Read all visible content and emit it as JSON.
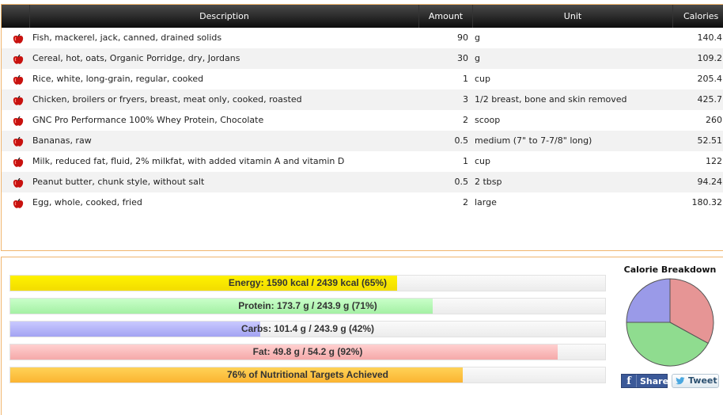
{
  "table": {
    "headers": {
      "description": "Description",
      "amount": "Amount",
      "unit": "Unit",
      "calories": "Calories"
    },
    "rows": [
      {
        "description": "Fish, mackerel, jack, canned, drained solids",
        "amount": "90",
        "unit": "g",
        "calories": "140.4"
      },
      {
        "description": "Cereal, hot, oats, Organic Porridge, dry, Jordans",
        "amount": "30",
        "unit": "g",
        "calories": "109.2"
      },
      {
        "description": "Rice, white, long-grain, regular, cooked",
        "amount": "1",
        "unit": "cup",
        "calories": "205.4"
      },
      {
        "description": "Chicken, broilers or fryers, breast, meat only, cooked, roasted",
        "amount": "3",
        "unit": "1/2 breast, bone and skin removed",
        "calories": "425.7"
      },
      {
        "description": "GNC Pro Performance 100% Whey Protein, Chocolate",
        "amount": "2",
        "unit": "scoop",
        "calories": "260"
      },
      {
        "description": "Bananas, raw",
        "amount": "0.5",
        "unit": "medium (7\" to 7-7/8\" long)",
        "calories": "52.51"
      },
      {
        "description": "Milk, reduced fat, fluid, 2% milkfat, with added vitamin A and vitamin D",
        "amount": "1",
        "unit": "cup",
        "calories": "122"
      },
      {
        "description": "Peanut butter, chunk style, without salt",
        "amount": "0.5",
        "unit": "2 tbsp",
        "calories": "94.24"
      },
      {
        "description": "Egg, whole, cooked, fried",
        "amount": "2",
        "unit": "large",
        "calories": "180.32"
      }
    ]
  },
  "nutrition": {
    "energy": {
      "label": "Energy: 1590 kcal / 2439 kcal (65%)",
      "percent": 65,
      "color": "#f7e600"
    },
    "protein": {
      "label": "Protein: 173.7 g / 243.9 g (71%)",
      "percent": 71,
      "color": "#b5f7b5"
    },
    "carbs": {
      "label": "Carbs: 101.4 g / 243.9 g (42%)",
      "percent": 42,
      "color": "#b5b5f7"
    },
    "fat": {
      "label": "Fat: 49.8 g / 54.2 g (92%)",
      "percent": 92,
      "color": "#f7bcbc"
    },
    "overall": {
      "label": "76% of Nutritional Targets Achieved",
      "percent": 76,
      "color": "#fcc23f"
    }
  },
  "chart_data": {
    "type": "pie",
    "title": "Calorie Breakdown",
    "series": [
      {
        "values": [
          33,
          42,
          25
        ],
        "colors": [
          "#e69595",
          "#8fdc8f",
          "#9a9ae8"
        ]
      }
    ]
  },
  "social": {
    "share_label": "Share",
    "tweet_label": "Tweet",
    "share_icon": "facebook-icon",
    "tweet_icon": "twitter-bird-icon"
  },
  "icons": {
    "row_icon": "red-apple-icon"
  }
}
